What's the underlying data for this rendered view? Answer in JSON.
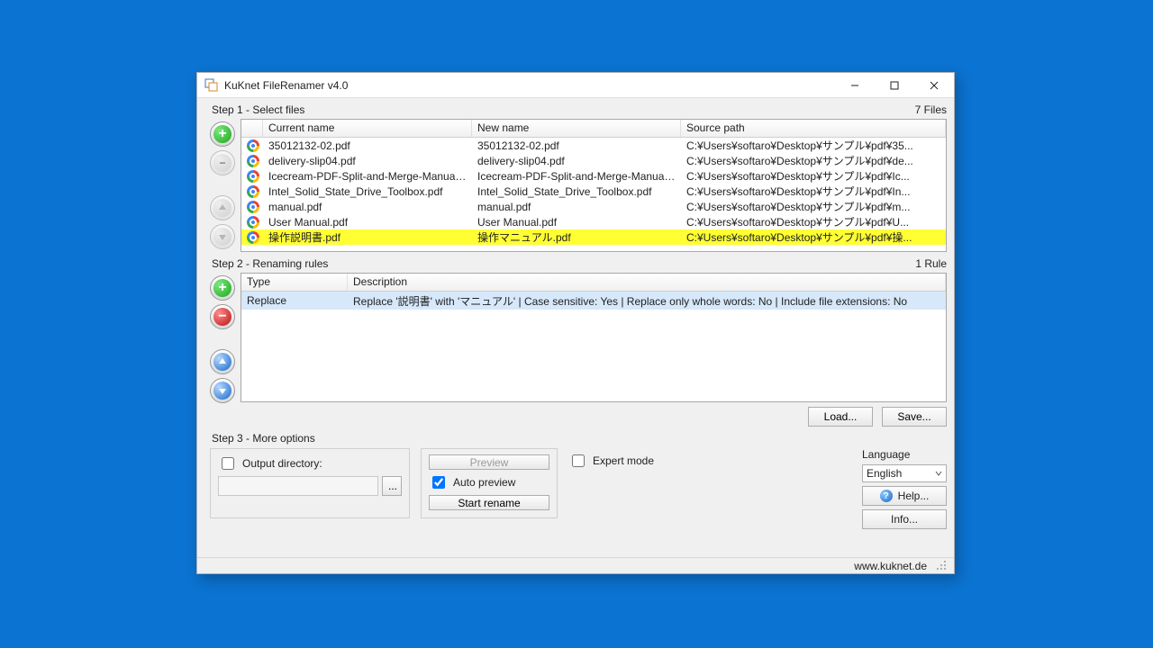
{
  "window": {
    "title": "KuKnet FileRenamer v4.0"
  },
  "step1": {
    "label": "Step 1 - Select files",
    "count_label": "7 Files",
    "columns": {
      "icon": "",
      "current": "Current name",
      "new": "New name",
      "path": "Source path"
    },
    "rows": [
      {
        "current": "35012132-02.pdf",
        "new": "35012132-02.pdf",
        "path": "C:¥Users¥softaro¥Desktop¥サンプル¥pdf¥35...",
        "highlight": false
      },
      {
        "current": "delivery-slip04.pdf",
        "new": "delivery-slip04.pdf",
        "path": "C:¥Users¥softaro¥Desktop¥サンプル¥pdf¥de...",
        "highlight": false
      },
      {
        "current": "Icecream-PDF-Split-and-Merge-Manual...",
        "new": "Icecream-PDF-Split-and-Merge-Manual...",
        "path": "C:¥Users¥softaro¥Desktop¥サンプル¥pdf¥Ic...",
        "highlight": false
      },
      {
        "current": "Intel_Solid_State_Drive_Toolbox.pdf",
        "new": "Intel_Solid_State_Drive_Toolbox.pdf",
        "path": "C:¥Users¥softaro¥Desktop¥サンプル¥pdf¥In...",
        "highlight": false
      },
      {
        "current": "manual.pdf",
        "new": "manual.pdf",
        "path": "C:¥Users¥softaro¥Desktop¥サンプル¥pdf¥m...",
        "highlight": false
      },
      {
        "current": "User Manual.pdf",
        "new": "User Manual.pdf",
        "path": "C:¥Users¥softaro¥Desktop¥サンプル¥pdf¥U...",
        "highlight": false
      },
      {
        "current": "操作説明書.pdf",
        "new": "操作マニュアル.pdf",
        "path": "C:¥Users¥softaro¥Desktop¥サンプル¥pdf¥操...",
        "highlight": true
      }
    ]
  },
  "step2": {
    "label": "Step 2 - Renaming rules",
    "count_label": "1 Rule",
    "columns": {
      "type": "Type",
      "desc": "Description"
    },
    "rows": [
      {
        "type": "Replace",
        "desc": "Replace '説明書' with 'マニュアル' | Case sensitive: Yes | Replace only whole words: No | Include file extensions: No",
        "selected": true
      }
    ],
    "load": "Load...",
    "save": "Save..."
  },
  "step3": {
    "label": "Step 3 - More options",
    "outdir_label": "Output directory:",
    "outdir_value": "",
    "browse": "...",
    "preview": "Preview",
    "autopreview": "Auto preview",
    "start": "Start rename",
    "expert": "Expert mode",
    "lang_label": "Language",
    "lang_value": "English",
    "help": "Help...",
    "info": "Info..."
  },
  "status": {
    "url": "www.kuknet.de"
  }
}
